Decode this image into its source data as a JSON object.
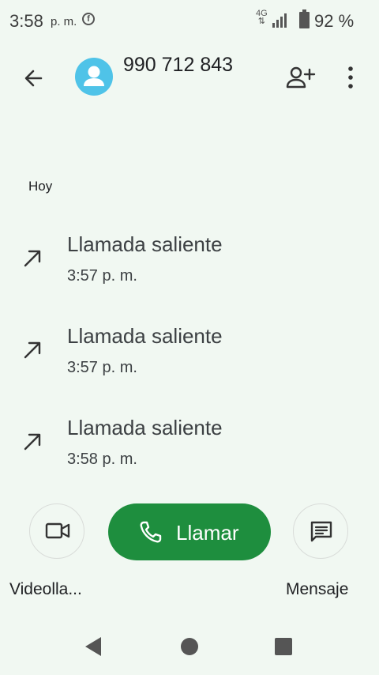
{
  "status_bar": {
    "time": "3:58",
    "ampm": "p. m.",
    "notification_icon": "facebook-icon",
    "network": "4G",
    "battery_percent": "92 %"
  },
  "header": {
    "phone_number": "990 712 843",
    "back_icon": "arrow-back-icon",
    "add_contact_icon": "person-add-icon",
    "menu_icon": "more-vert-icon"
  },
  "section": {
    "title": "Hoy"
  },
  "calls": [
    {
      "type": "Llamada saliente",
      "time": "3:57 p. m."
    },
    {
      "type": "Llamada saliente",
      "time": "3:57 p. m."
    },
    {
      "type": "Llamada saliente",
      "time": "3:58 p. m."
    }
  ],
  "actions": {
    "video_label": "Videolla...",
    "call_label": "Llamar",
    "message_label": "Mensaje"
  },
  "colors": {
    "background": "#f1f8f2",
    "call_button": "#1e8e3e",
    "avatar": "#4fc3e8"
  }
}
